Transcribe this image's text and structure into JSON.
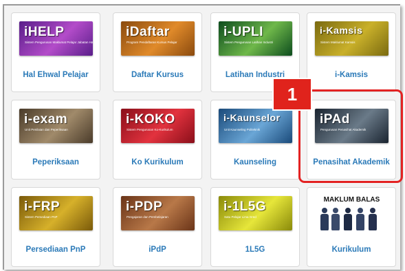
{
  "tiles": [
    {
      "label": "Hal Ehwal Pelajar",
      "banner_title": "iHELP",
      "banner_sub": "Sistem Pengurusan Maklumat Pelajar\nJabatan Hal Ehwal Pelajar",
      "colors": [
        "#5a1e8a",
        "#b34cc9"
      ]
    },
    {
      "label": "Daftar Kursus",
      "banner_title": "iDaftar",
      "banner_sub": "Program Pendaftaran Kursus Pelajar",
      "colors": [
        "#8a4a0e",
        "#e08a2a"
      ]
    },
    {
      "label": "Latihan Industri",
      "banner_title": "i-UPLI",
      "banner_sub": "Sistem Pengurusan Latihan Industri",
      "colors": [
        "#0d4d1e",
        "#6fb84a"
      ]
    },
    {
      "label": "i-Kamsis",
      "banner_title": "i-Kamsis",
      "banner_sub": "Sistem Maklumat Kamsis",
      "colors": [
        "#7a6a10",
        "#c9b02a"
      ]
    },
    {
      "label": "Peperiksaan",
      "banner_title": "i-exam",
      "banner_sub": "Unit Penilaian dan Peperiksaan",
      "colors": [
        "#4a3b2a",
        "#a08a6a"
      ]
    },
    {
      "label": "Ko Kurikulum",
      "banner_title": "i-KOKO",
      "banner_sub": "Sistem Pengurusan Ko-Kurikulum",
      "colors": [
        "#8a0f1a",
        "#e2323e"
      ]
    },
    {
      "label": "Kaunseling",
      "banner_title": "i-Kaunselor",
      "banner_sub": "Unit Kaunseling Politeknik",
      "colors": [
        "#1a4a7a",
        "#6aa6d6"
      ]
    },
    {
      "label": "Penasihat Akademik",
      "banner_title": "iPAd",
      "banner_sub": "Pengurusan Penasihat Akademik",
      "colors": [
        "#1a2430",
        "#6a7a88"
      ]
    },
    {
      "label": "Persediaan PnP",
      "banner_title": "i-FRP",
      "banner_sub": "Sistem Persediaan PnP",
      "colors": [
        "#7a5a0a",
        "#d6b02a"
      ]
    },
    {
      "label": "iPdP",
      "banner_title": "i-PDP",
      "banner_sub": "Pengajaran dan Pembelajaran",
      "colors": [
        "#6a3418",
        "#b87848"
      ]
    },
    {
      "label": "1L5G",
      "banner_title": "i-1L5G",
      "banner_sub": "Satu Pelajar Lima Gred",
      "colors": [
        "#8a8a0a",
        "#e6e63a"
      ]
    },
    {
      "label": "Kurikulum",
      "banner_title": "MAKLUM BALAS",
      "banner_sub": "",
      "colors": [
        "#ffffff",
        "#ffffff"
      ]
    }
  ],
  "callout": {
    "number": "1",
    "color": "#e0231c"
  }
}
